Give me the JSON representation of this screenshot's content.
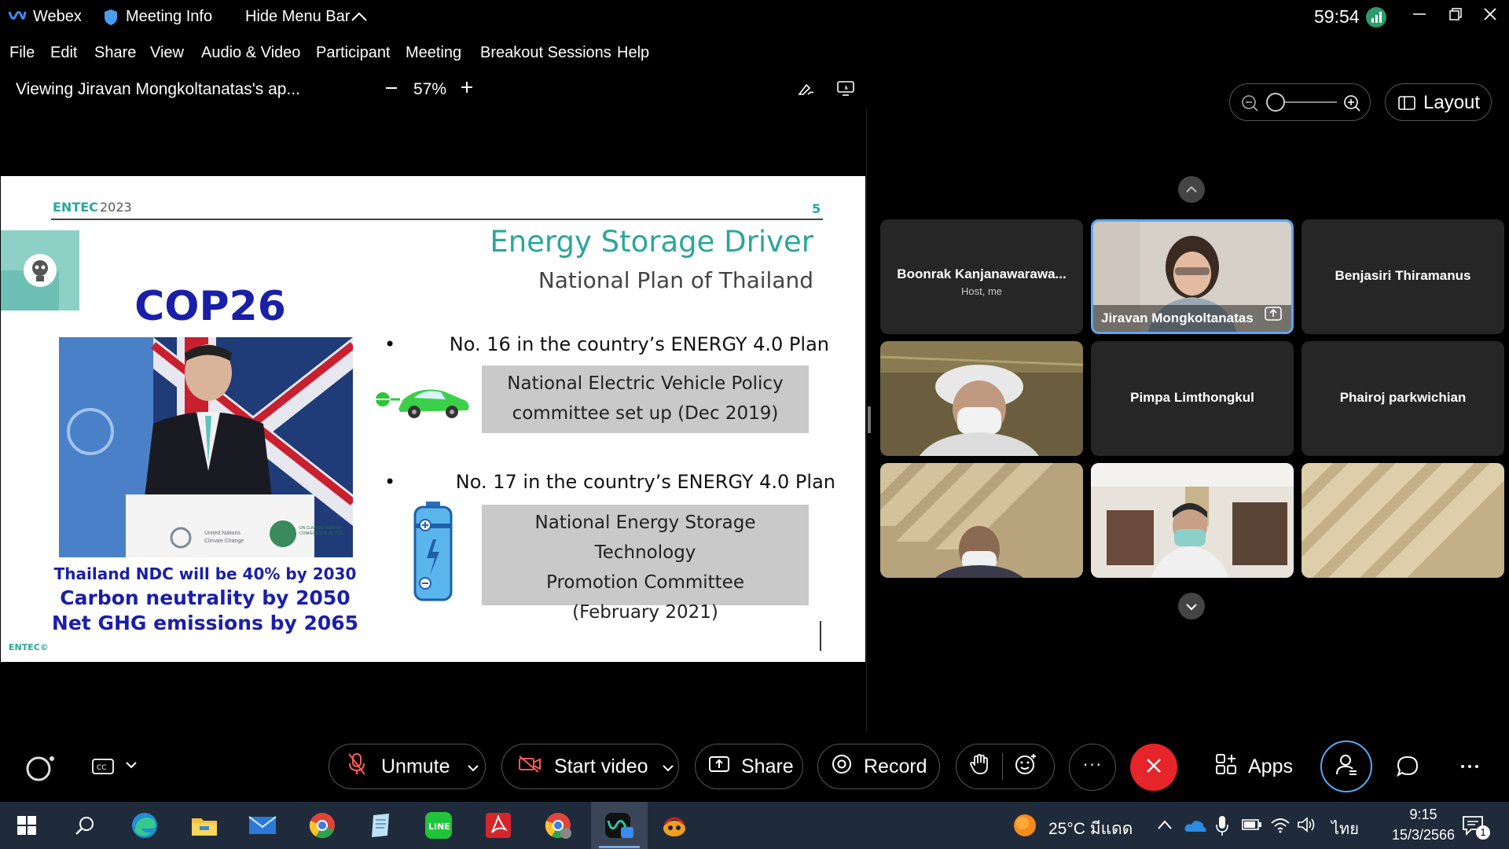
{
  "titlebar": {
    "app_name": "Webex",
    "meeting_info": "Meeting Info",
    "hide_menu": "Hide Menu Bar",
    "timer": "59:54"
  },
  "menu": [
    "File",
    "Edit",
    "Share",
    "View",
    "Audio & Video",
    "Participant",
    "Meeting",
    "Breakout Sessions",
    "Help"
  ],
  "sharebar": {
    "viewing": "Viewing Jiravan Mongkoltanatas's ap...",
    "zoom": "57%"
  },
  "view_controls": {
    "layout_label": "Layout"
  },
  "slide": {
    "header_brand": "ENTEC",
    "header_year": "2023",
    "page_number": "5",
    "title": "Energy Storage Driver",
    "subtitle": "National Plan of Thailand",
    "cop_title": "COP26",
    "ndc_line1": "Thailand NDC will be 40% by 2030",
    "ndc_line2": "Carbon neutrality by 2050",
    "ndc_line3": "Net GHG emissions by 2065",
    "bullet1": "No. 16 in the country’s ENERGY 4.0 Plan",
    "box1_line1": "National Electric Vehicle Policy",
    "box1_line2": "committee set up (Dec 2019)",
    "bullet2": "No. 17 in the country’s ENERGY 4.0 Plan",
    "box2_line1": "National Energy Storage Technology",
    "box2_line2": "Promotion Committee",
    "box2_line3": "(February 2021)",
    "footer": "ENTEC©",
    "podium_text1": "United Nations",
    "podium_text2": "Climate Change",
    "podium_text3": "UN CLIMATE CHANGE CONFERENCE UK 2021"
  },
  "participants": [
    {
      "name": "Boonrak Kanjanawarawa...",
      "sub": "Host, me"
    },
    {
      "name": "Jiravan Mongkoltanatas"
    },
    {
      "name": "Benjasiri Thiramanus"
    },
    {
      "name": ""
    },
    {
      "name": "Pimpa Limthongkul"
    },
    {
      "name": "Phairoj parkwichian"
    }
  ],
  "controls": {
    "unmute": "Unmute",
    "start_video": "Start video",
    "share": "Share",
    "record": "Record",
    "apps": "Apps",
    "more": "···"
  },
  "taskbar": {
    "weather": "25°C มีแดด",
    "lang": "ไทย",
    "time": "9:15",
    "date": "15/3/2566",
    "notif_count": "1"
  },
  "colors": {
    "teal": "#2aa79b",
    "cop_blue": "#1a1fa8",
    "end_red": "#e5252a",
    "active_border": "#5aa7f5"
  }
}
